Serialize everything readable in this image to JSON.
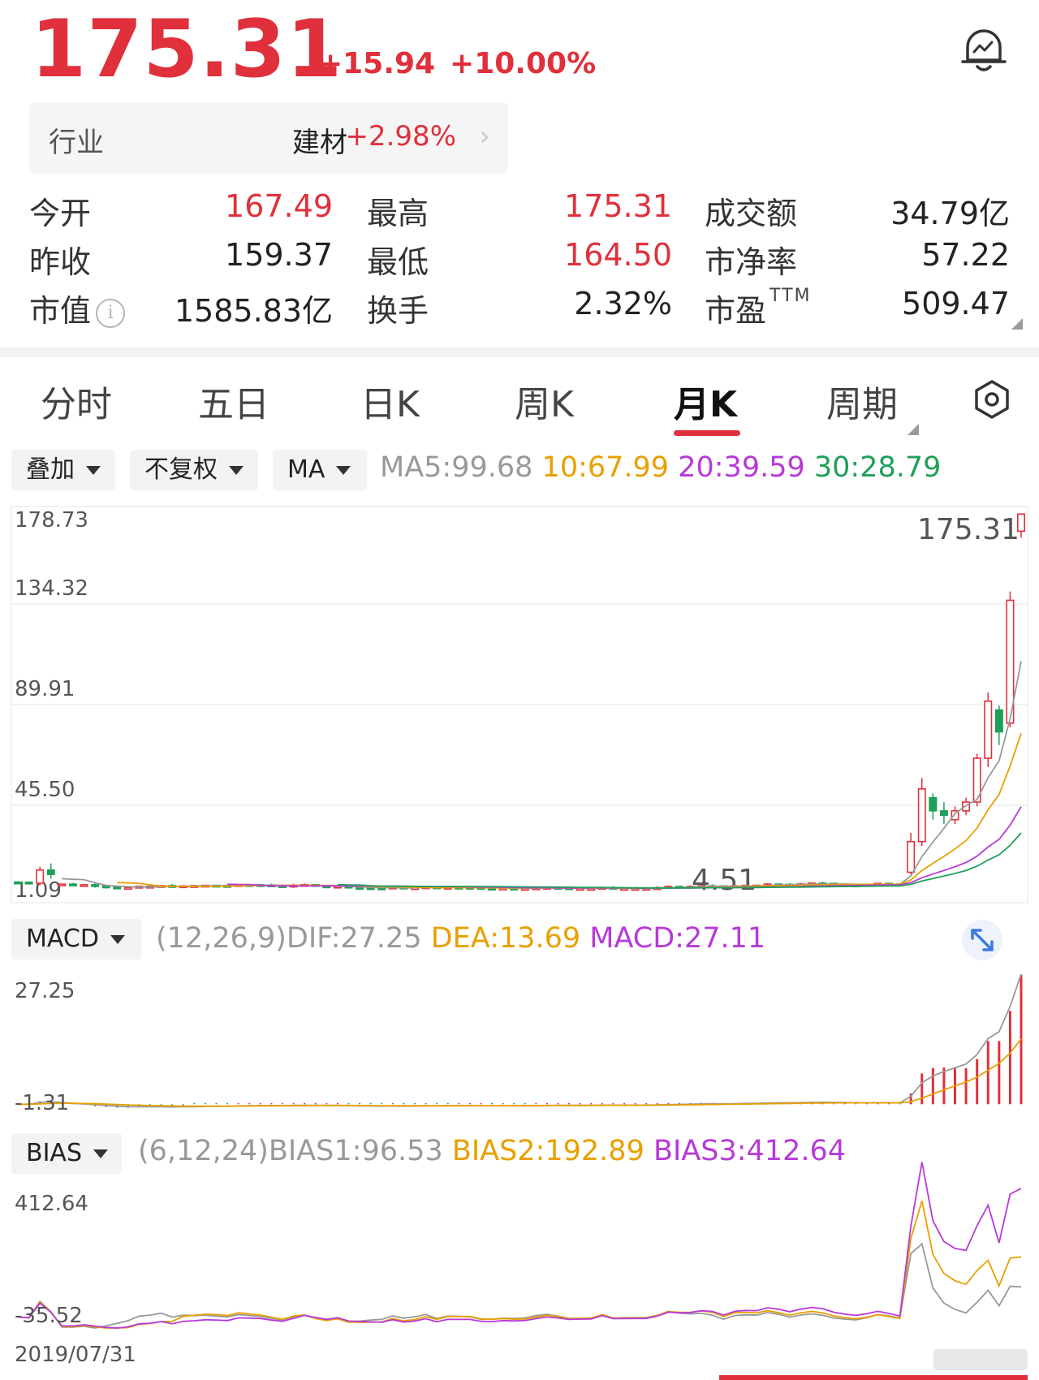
{
  "quote": {
    "price": "175.31",
    "change": "+15.94",
    "change_pct": "+10.00%",
    "industry_label": "行业",
    "industry_name": "建材",
    "industry_pct": "+2.98%",
    "stats": [
      {
        "label": "今开",
        "value": "167.49",
        "color": "red"
      },
      {
        "label": "最高",
        "value": "175.31",
        "color": "red"
      },
      {
        "label": "成交额",
        "value": "34.79亿",
        "color": "black"
      },
      {
        "label": "昨收",
        "value": "159.37",
        "color": "black"
      },
      {
        "label": "最低",
        "value": "164.50",
        "color": "red"
      },
      {
        "label": "市净率",
        "value": "57.22",
        "color": "black"
      },
      {
        "label": "市值",
        "value": "1585.83亿",
        "color": "black"
      },
      {
        "label": "换手",
        "value": "2.32%",
        "color": "black"
      },
      {
        "label": "市盈",
        "value": "509.47",
        "color": "black"
      }
    ],
    "pe_suffix": "TTM",
    "info_glyph": "i"
  },
  "tabs": [
    {
      "label": "分时",
      "active": false
    },
    {
      "label": "五日",
      "active": false
    },
    {
      "label": "日K",
      "active": false
    },
    {
      "label": "周K",
      "active": false
    },
    {
      "label": "月K",
      "active": true
    },
    {
      "label": "周期",
      "active": false
    }
  ],
  "selectors": {
    "overlay": "叠加",
    "adjust": "不复权",
    "ma": "MA"
  },
  "ma_legend": {
    "ma5": "MA5:99.68",
    "ma10": "10:67.99",
    "ma20": "20:39.59",
    "ma30": "30:28.79"
  },
  "macd": {
    "selector": "MACD",
    "params": "(12,26,9)",
    "dif": "DIF:27.25",
    "dea": "DEA:13.69",
    "macd": "MACD:27.11",
    "axis_top": "27.25",
    "axis_bottom": "-1.31"
  },
  "bias": {
    "selector": "BIAS",
    "params": "(6,12,24)",
    "bias1": "BIAS1:96.53",
    "bias2": "BIAS2:192.89",
    "bias3": "BIAS3:412.64",
    "axis_top": "412.64",
    "axis_bottom": "-35.52"
  },
  "chart_data": [
    {
      "type": "candlestick",
      "title": "月K",
      "y_ticks": [
        "178.73",
        "134.32",
        "89.91",
        "45.50",
        "1.09"
      ],
      "ylim": [
        1.09,
        178.73
      ],
      "annotations": [
        {
          "text": "175.31",
          "label": "max"
        },
        {
          "text": "4.51",
          "label": "min"
        }
      ],
      "x_start_label": "2019/07/31",
      "series": [
        {
          "name": "MA5",
          "color": "#999999"
        },
        {
          "name": "MA10",
          "color": "#e8a000"
        },
        {
          "name": "MA20",
          "color": "#b73ad8"
        },
        {
          "name": "MA30",
          "color": "#1fa05a"
        }
      ],
      "recent_candles": [
        {
          "o": 12,
          "c": 26,
          "h": 30,
          "l": 11
        },
        {
          "o": 26,
          "c": 50,
          "h": 55,
          "l": 24
        },
        {
          "o": 46,
          "c": 40,
          "h": 48,
          "l": 36
        },
        {
          "o": 40,
          "c": 38,
          "h": 44,
          "l": 34
        },
        {
          "o": 36,
          "c": 40,
          "h": 42,
          "l": 34
        },
        {
          "o": 40,
          "c": 44,
          "h": 46,
          "l": 38
        },
        {
          "o": 44,
          "c": 64,
          "h": 66,
          "l": 42
        },
        {
          "o": 64,
          "c": 90,
          "h": 94,
          "l": 60
        },
        {
          "o": 86,
          "c": 76,
          "h": 88,
          "l": 70
        },
        {
          "o": 80,
          "c": 136,
          "h": 140,
          "l": 78
        },
        {
          "o": 167.49,
          "c": 175.31,
          "h": 175.31,
          "l": 164.5
        }
      ]
    },
    {
      "type": "bar",
      "title": "MACD",
      "y_ticks": [
        "27.25",
        "-1.31"
      ],
      "ylim": [
        -1.31,
        27.25
      ],
      "series": [
        {
          "name": "DIF",
          "last": 27.25
        },
        {
          "name": "DEA",
          "last": 13.69
        },
        {
          "name": "MACD",
          "last": 27.11
        }
      ]
    },
    {
      "type": "line",
      "title": "BIAS",
      "y_ticks": [
        "412.64",
        "-35.52"
      ],
      "ylim": [
        -35.52,
        412.64
      ],
      "series": [
        {
          "name": "BIAS1",
          "last": 96.53
        },
        {
          "name": "BIAS2",
          "last": 192.89
        },
        {
          "name": "BIAS3",
          "last": 412.64
        }
      ]
    }
  ]
}
